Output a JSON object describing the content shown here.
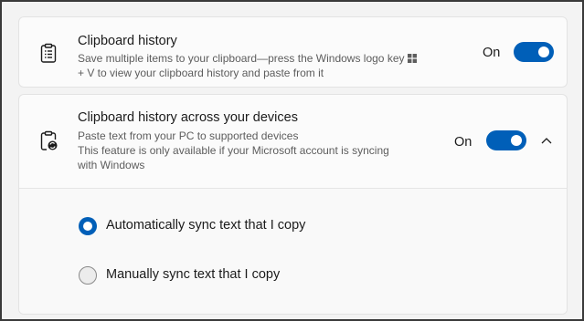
{
  "clipboard_history": {
    "title": "Clipboard history",
    "description_part1": "Save multiple items to your clipboard—press the Windows logo key",
    "description_part2": "+ V to view your clipboard history and paste from it",
    "state_label": "On",
    "toggle_on": true,
    "icon": "clipboard-list-icon"
  },
  "sync_devices": {
    "title": "Clipboard history across your devices",
    "description_line1": "Paste text from your PC to supported devices",
    "description_line2": "This feature is only available if your Microsoft account is syncing",
    "description_line3": "with Windows",
    "state_label": "On",
    "toggle_on": true,
    "icon": "clipboard-sync-icon",
    "expanded": true,
    "options": [
      {
        "label": "Automatically sync text that I copy",
        "selected": true
      },
      {
        "label": "Manually sync text that I copy",
        "selected": false
      }
    ]
  },
  "colors": {
    "accent": "#005fb8",
    "background": "#f3f3f3",
    "card": "#fbfbfb"
  }
}
